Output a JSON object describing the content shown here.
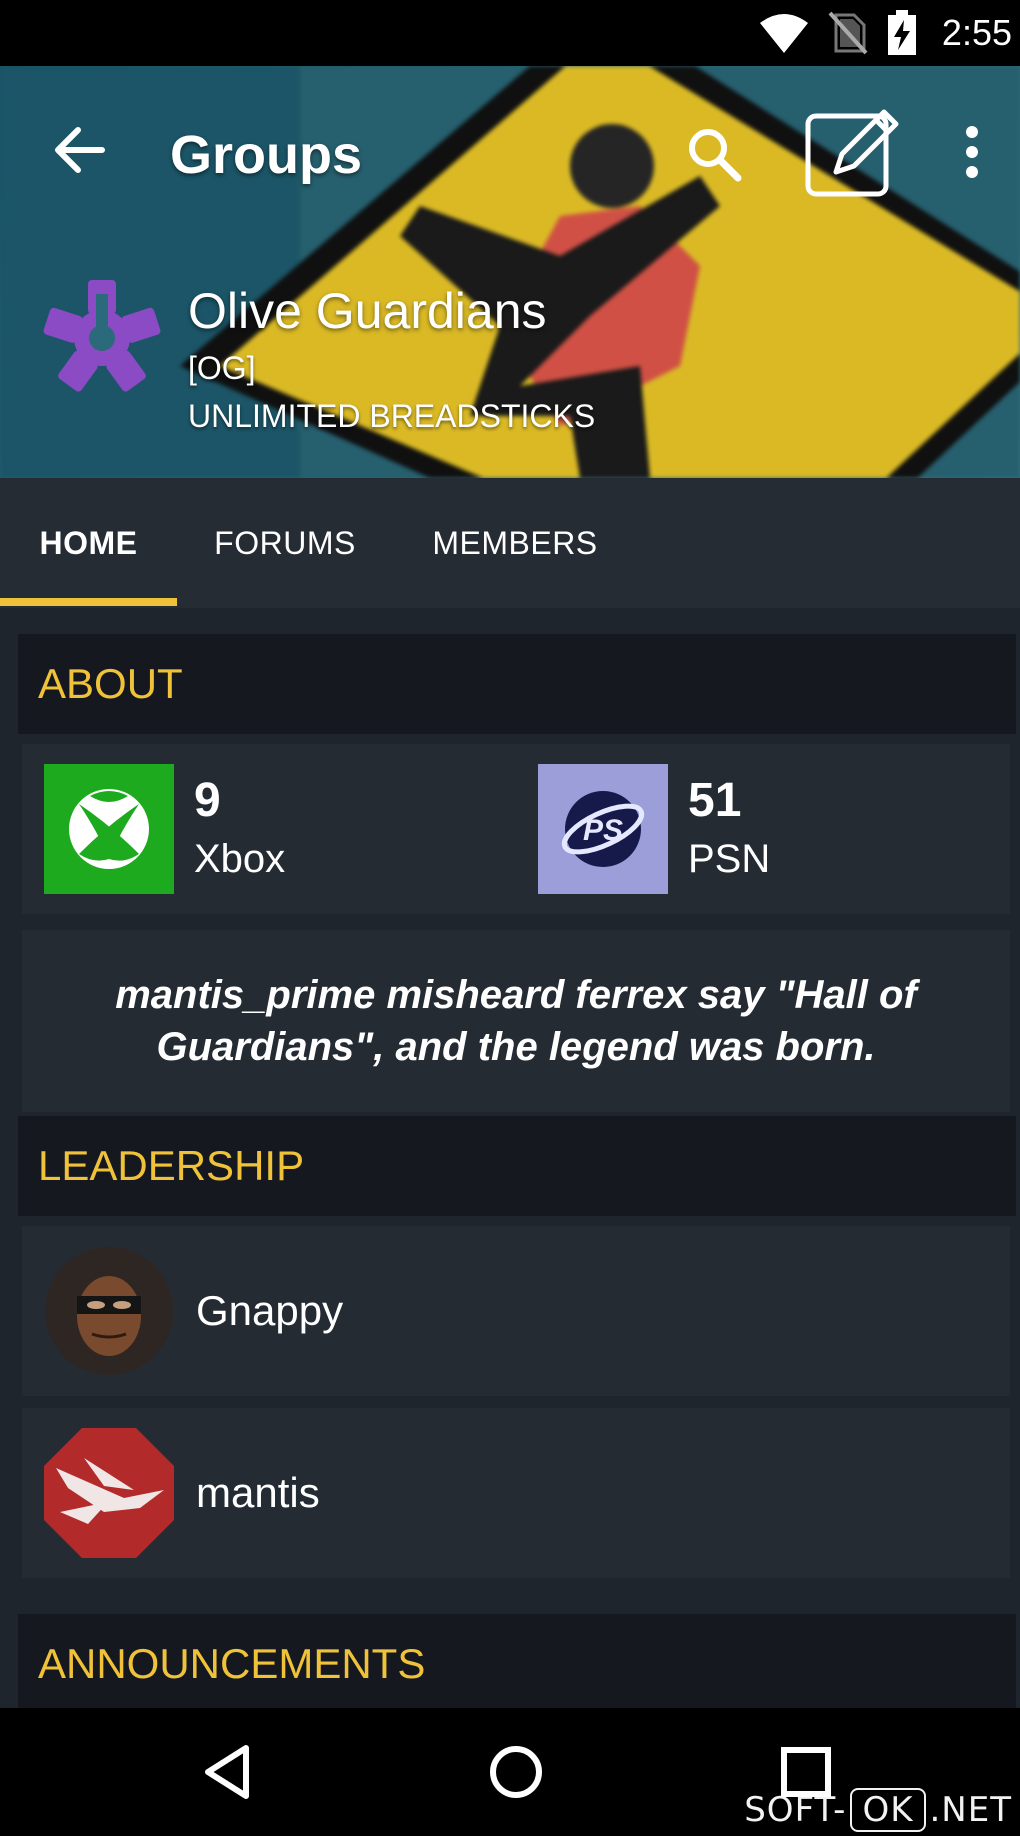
{
  "status_bar": {
    "time": "2:55"
  },
  "appbar": {
    "title": "Groups"
  },
  "group": {
    "name": "Olive Guardians",
    "tag": "[OG]",
    "motto": "UNLIMITED BREADSTICKS"
  },
  "tabs": [
    {
      "label": "HOME",
      "active": true
    },
    {
      "label": "FORUMS",
      "active": false
    },
    {
      "label": "MEMBERS",
      "active": false
    }
  ],
  "about": {
    "header": "ABOUT",
    "platforms": [
      {
        "count": "9",
        "name": "Xbox",
        "icon": "xbox-icon",
        "color": "#1eaa1e"
      },
      {
        "count": "51",
        "name": "PSN",
        "icon": "psn-icon",
        "color": "#9b9ed8"
      }
    ],
    "quote": "mantis_prime misheard ferrex say \"Hall of Guardians\", and the legend was born."
  },
  "leadership": {
    "header": "LEADERSHIP",
    "members": [
      {
        "name": "Gnappy",
        "avatar": "ninja-avatar"
      },
      {
        "name": "mantis",
        "avatar": "hawk-emblem-avatar"
      }
    ]
  },
  "announcements": {
    "header": "ANNOUNCEMENTS"
  },
  "watermark": {
    "prefix": "SOFT-",
    "boxed": "OK",
    "suffix": ".NET"
  },
  "colors": {
    "accent": "#f0c23a",
    "logo_purple": "#8a4bc4",
    "xbox_green": "#1eaa1e"
  }
}
